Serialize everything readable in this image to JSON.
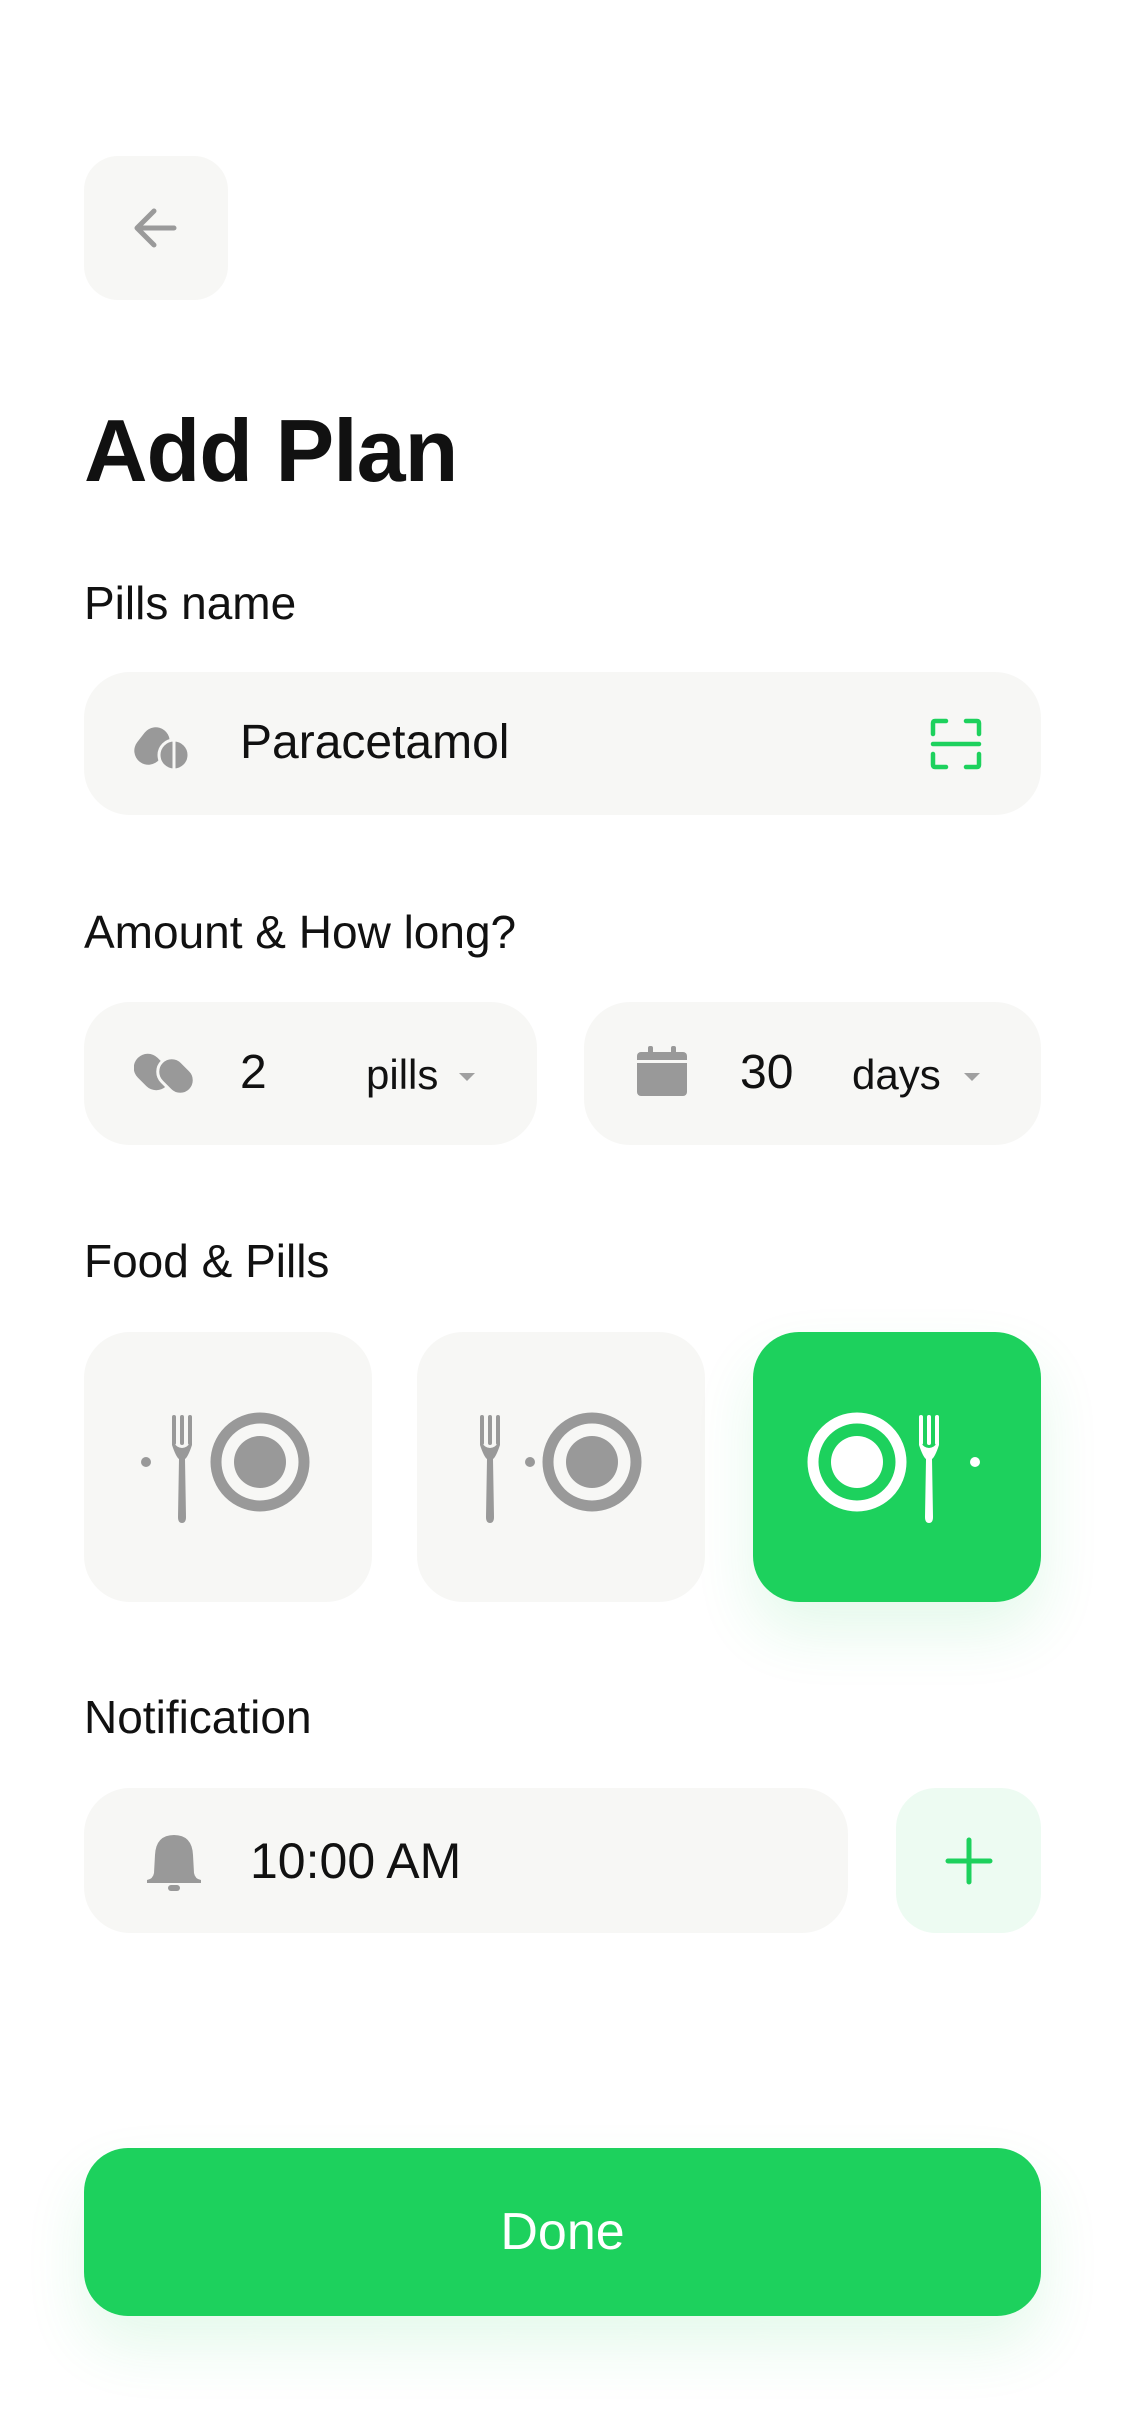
{
  "page": {
    "title": "Add Plan"
  },
  "pills_name": {
    "label": "Pills name",
    "value": "Paracetamol",
    "icon": "pill-icon",
    "scan_icon": "scan-icon"
  },
  "amount": {
    "label": "Amount & How long?",
    "pills_count": "2",
    "pills_unit": "pills",
    "days_count": "30",
    "days_unit": "days"
  },
  "food": {
    "label": "Food & Pills",
    "options": [
      {
        "icon": "before-food-icon",
        "selected": false
      },
      {
        "icon": "with-food-icon",
        "selected": false
      },
      {
        "icon": "after-food-icon",
        "selected": true
      }
    ]
  },
  "notification": {
    "label": "Notification",
    "time": "10:00 AM"
  },
  "done_label": "Done",
  "colors": {
    "accent": "#1DD15D",
    "field_bg": "#F7F7F5",
    "icon_gray": "#999999",
    "add_bg": "#EDFBF2"
  }
}
